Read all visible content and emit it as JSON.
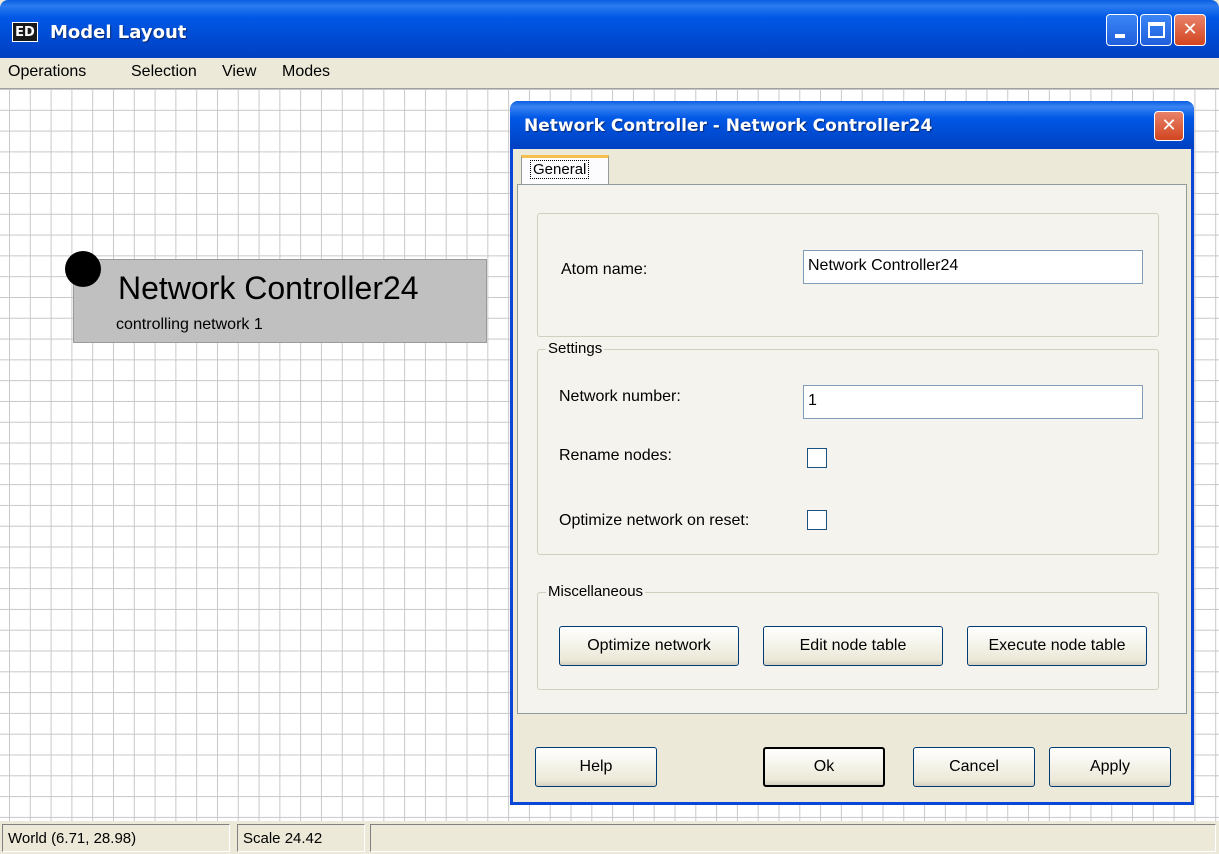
{
  "window": {
    "title": "Model Layout",
    "app_icon_text": "ED"
  },
  "menu": [
    {
      "label": "Operations"
    },
    {
      "label": "Selection"
    },
    {
      "label": "View"
    },
    {
      "label": "Modes"
    }
  ],
  "canvas": {
    "atom_label": "Network Controller24",
    "atom_description": "controlling network 1"
  },
  "statusbar": {
    "world": "World (6.71, 28.98)",
    "scale": "Scale 24.42"
  },
  "dialog": {
    "title": "Network Controller - Network Controller24",
    "tab_label": "General",
    "atom_name_label": "Atom name:",
    "atom_name_value": "Network Controller24",
    "settings_caption": "Settings",
    "network_number_label": "Network number:",
    "network_number_value": "1",
    "rename_nodes_label": "Rename nodes:",
    "rename_nodes_checked": false,
    "optimize_reset_label": "Optimize network on reset:",
    "optimize_reset_checked": false,
    "misc_caption": "Miscellaneous",
    "optimize_btn": "Optimize network",
    "edit_table_btn": "Edit node table",
    "execute_table_btn": "Execute node table",
    "help_btn": "Help",
    "ok_btn": "Ok",
    "cancel_btn": "Cancel",
    "apply_btn": "Apply"
  },
  "colors": {
    "titlebar_blue": "#0058e6",
    "close_red": "#d2451f",
    "window_bg": "#ece9d8",
    "atom_fill": "#c0c0c0"
  }
}
